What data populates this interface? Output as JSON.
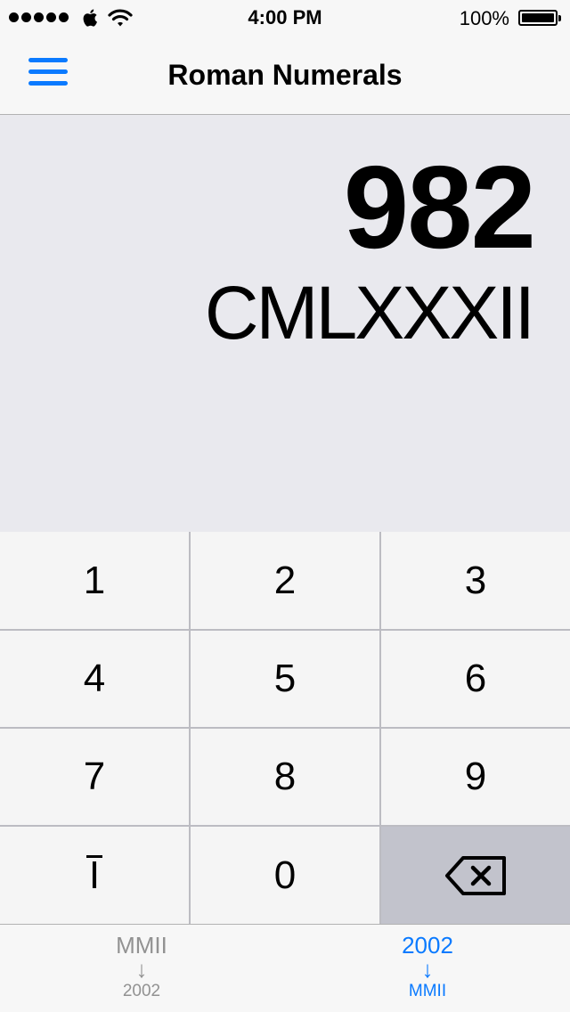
{
  "status_bar": {
    "time": "4:00 PM",
    "battery": "100%",
    "icons": [
      "signal-dots-icon",
      "apple-icon",
      "wifi-icon",
      "battery-icon"
    ]
  },
  "nav": {
    "title": "Roman Numerals",
    "menu_icon": "hamburger-menu-icon"
  },
  "display": {
    "arabic": "982",
    "roman": "CMLXXXII"
  },
  "keypad": {
    "keys": [
      "1",
      "2",
      "3",
      "4",
      "5",
      "6",
      "7",
      "8",
      "9",
      "Ī",
      "0"
    ],
    "overline_key_base": "I",
    "backspace_icon": "backspace-icon"
  },
  "tabs": [
    {
      "from": "MMII",
      "arrow": "↓",
      "to": "2002",
      "state": "inactive"
    },
    {
      "from": "2002",
      "arrow": "↓",
      "to": "MMII",
      "state": "active"
    }
  ],
  "colors": {
    "accent": "#0a7aff",
    "display_bg": "#e9e9ee",
    "key_bg": "#f5f5f5",
    "backspace_bg": "#c2c3cc",
    "inactive_tab": "#929292"
  }
}
